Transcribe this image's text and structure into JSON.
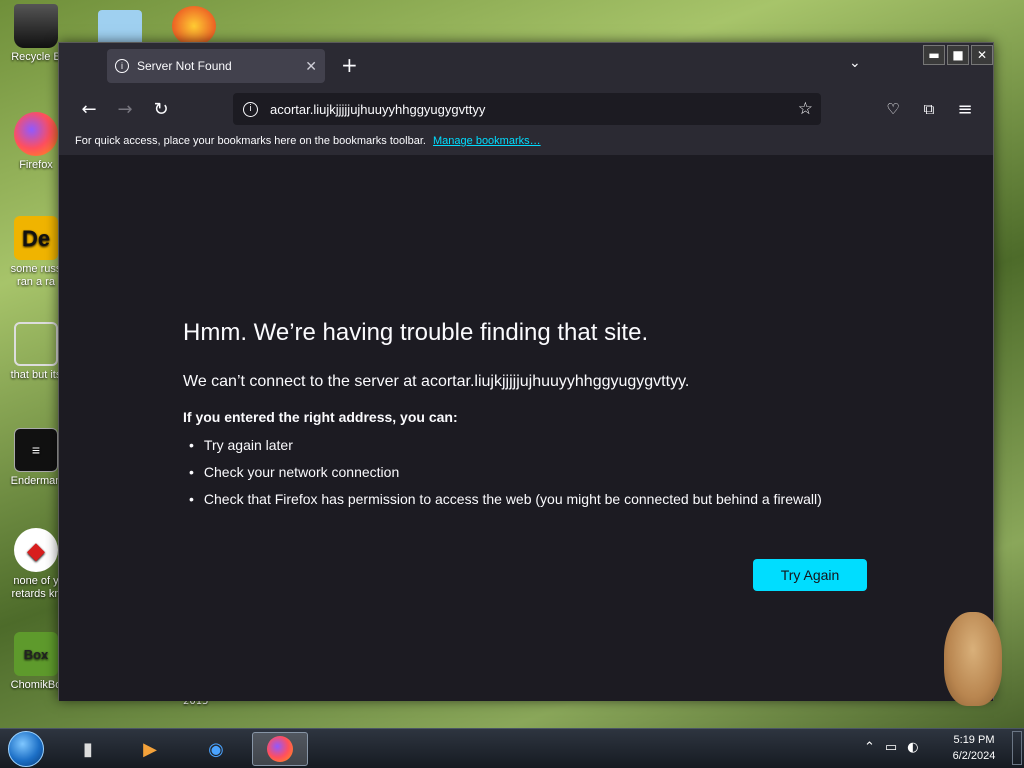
{
  "desktop": {
    "icons": [
      {
        "label": "Recycle B",
        "icon": "recycle-bin-icon"
      },
      {
        "label": "Firefox",
        "icon": "firefox-icon"
      },
      {
        "label": "some russ\nran a ra",
        "icon": "app-icon"
      },
      {
        "label": "that but its",
        "icon": "copy-icon"
      },
      {
        "label": "Enderman",
        "icon": "terminal-icon"
      },
      {
        "label": "none of y\nretards kn",
        "icon": "dino-icon"
      },
      {
        "label": "ChomikBo",
        "icon": "hamster-box-icon"
      }
    ],
    "stray_text": "2015"
  },
  "browser": {
    "tab": {
      "title": "Server Not Found",
      "close": "✕"
    },
    "new_tab": "+",
    "tab_list": "⌄",
    "window_controls": {
      "minimize": "▬",
      "maximize": "■",
      "close": "✕"
    },
    "url": "acortar.liujkjjjjjujhuuyyhhggyugygvttyy",
    "bookmarks_bar": {
      "text": "For quick access, place your bookmarks here on the bookmarks toolbar.",
      "link": "Manage bookmarks…"
    },
    "error": {
      "heading": "Hmm. We’re having trouble finding that site.",
      "message": "We can’t connect to the server at acortar.liujkjjjjjujhuuyyhhggyugygvttyy.",
      "hint": "If you entered the right address, you can:",
      "suggestions": [
        "Try again later",
        "Check your network connection",
        "Check that Firefox has permission to access the web (you might be connected but behind a firewall)"
      ],
      "button": "Try Again"
    }
  },
  "taskbar": {
    "time": "5:19 PM",
    "date": "6/2/2024"
  },
  "colors": {
    "accent": "#00ddff",
    "window_bg": "#1c1b22",
    "toolbar_bg": "#2b2a33"
  }
}
